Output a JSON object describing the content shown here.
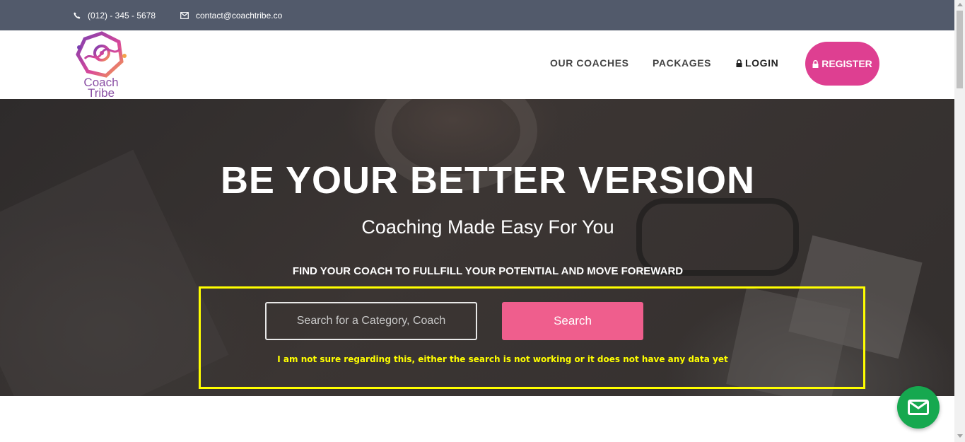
{
  "topbar": {
    "phone": "(012) - 345 - 5678",
    "phone_icon": "phone-icon",
    "email": "contact@coachtribe.co",
    "email_icon": "envelope-icon"
  },
  "navbar": {
    "logo_text_line1": "Coach",
    "logo_text_line2": "Tribe",
    "links": [
      {
        "label": "OUR COACHES"
      },
      {
        "label": "PACKAGES"
      },
      {
        "label": "LOGIN",
        "icon": "lock-icon"
      }
    ],
    "register": {
      "label": "REGISTER",
      "icon": "lock-icon"
    }
  },
  "hero": {
    "title": "BE YOUR BETTER VERSION",
    "subtitle": "Coaching Made Easy For You",
    "find_text": "FIND YOUR COACH TO FULLFILL YOUR POTENTIAL AND MOVE FOREWARD",
    "search": {
      "placeholder": "Search for a Category, Coach",
      "value": "",
      "button_label": "Search"
    },
    "annotation": "I am not sure regarding this, either the search is not working or it does not have any data yet"
  },
  "floating": {
    "icon": "mail-icon"
  },
  "colors": {
    "topbar_bg": "#525a6b",
    "register_bg": "#de3f91",
    "search_button_bg": "#ef5e8d",
    "annotation": "#ffff00",
    "fab_bg": "#16a84f"
  }
}
